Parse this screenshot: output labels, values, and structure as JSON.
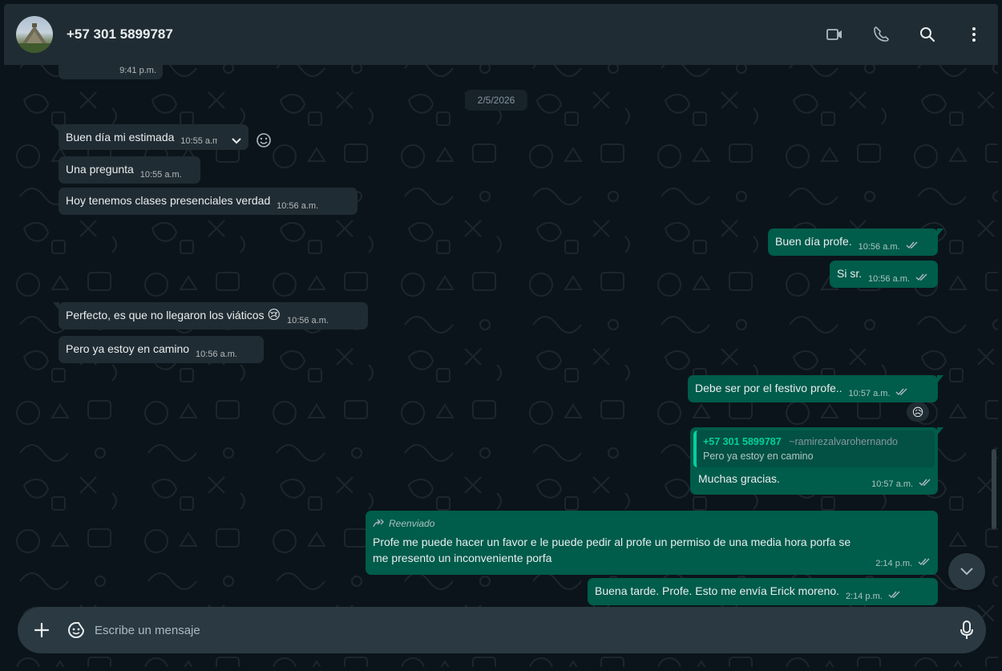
{
  "header": {
    "contact_name": "+57 301 5899787"
  },
  "chat": {
    "prev_time": "9:41 p.m.",
    "date_divider": "2/5/2026",
    "messages": [
      {
        "dir": "in",
        "text": "Buen día mi estimada",
        "time": "10:55 a.m."
      },
      {
        "dir": "in",
        "text": "Una pregunta",
        "time": "10:55 a.m."
      },
      {
        "dir": "in",
        "text": "Hoy tenemos clases presenciales verdad",
        "time": "10:56 a.m."
      },
      {
        "dir": "out",
        "text": "Buen día profe.",
        "time": "10:56 a.m."
      },
      {
        "dir": "out",
        "text": "Si sr.",
        "time": "10:56 a.m."
      },
      {
        "dir": "in",
        "text": "Perfecto, es que no llegaron los viáticos",
        "emoji": "😢",
        "time": "10:56 a.m."
      },
      {
        "dir": "in",
        "text": "Pero ya estoy en camino",
        "time": "10:56 a.m."
      },
      {
        "dir": "out",
        "text": "Debe ser por el festivo profe..",
        "time": "10:57 a.m.",
        "reaction": "😥"
      },
      {
        "dir": "out",
        "quote_number": "+57 301 5899787",
        "quote_user": "~ramirezalvarohernando",
        "quote_text": "Pero ya estoy en camino",
        "text": "Muchas gracias.",
        "time": "10:57 a.m."
      },
      {
        "dir": "out",
        "forwarded_label": "Reenviado",
        "text_line1": "Profe me puede hacer un favor e le puede pedir al profe un permiso de una media hora porfa se",
        "text_line2": "me presento un inconveniente porfa",
        "time": "2:14 p.m."
      },
      {
        "dir": "out",
        "text": "Buena tarde. Profe. Esto me envía Erick moreno.",
        "time": "2:14 p.m."
      }
    ]
  },
  "input": {
    "placeholder": "Escribe un mensaje"
  },
  "colors": {
    "background": "#0b141a",
    "header": "#202c33",
    "incoming_bubble": "#202c33",
    "outgoing_bubble": "#005c4b",
    "accent": "#06cf9c",
    "input_bar": "#2a3942"
  },
  "icons": [
    "video-call-icon",
    "voice-call-icon",
    "search-icon",
    "menu-icon",
    "plus-icon",
    "sticker-icon",
    "microphone-icon",
    "chevron-down-icon",
    "double-check-icon",
    "smiley-icon",
    "forward-icon"
  ]
}
